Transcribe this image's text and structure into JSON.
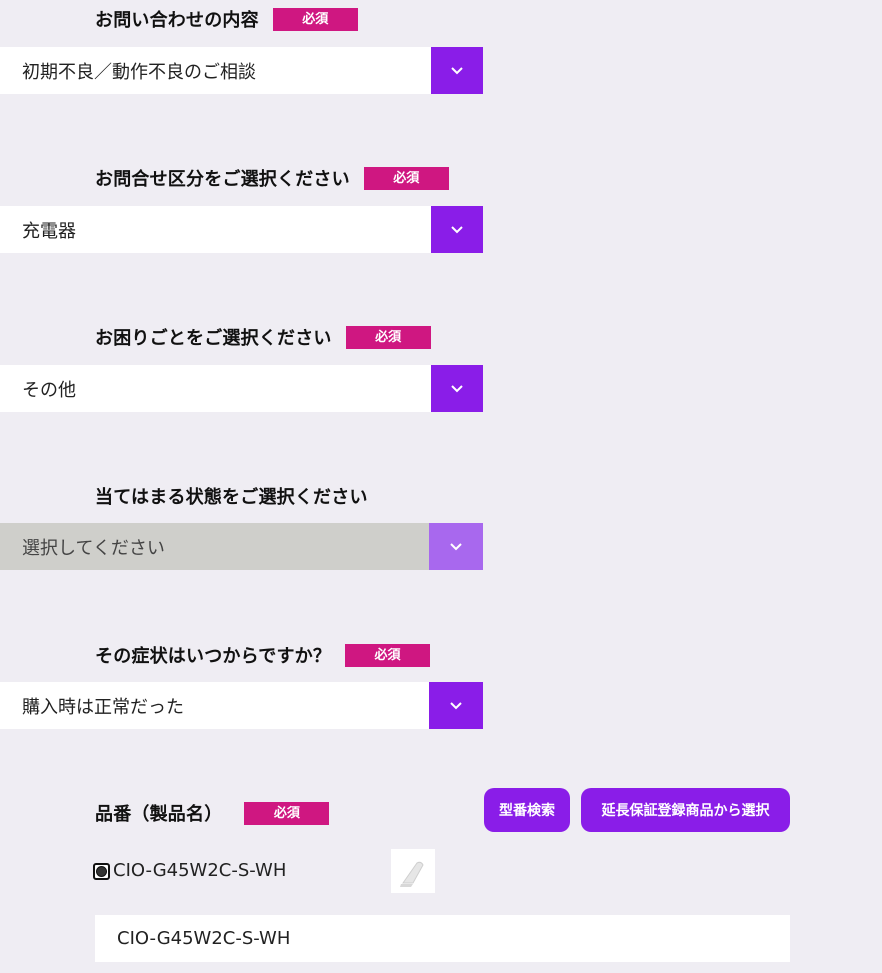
{
  "required_badge": "必須",
  "fields": [
    {
      "label": "お問い合わせの内容",
      "value": "初期不良／動作不良のご相談",
      "required": true
    },
    {
      "label": "お問合せ区分をご選択ください",
      "value": "充電器",
      "required": true
    },
    {
      "label": "お困りごとをご選択ください",
      "value": "その他",
      "required": true
    },
    {
      "label": "当てはまる状態をご選択ください",
      "value": "選択してください",
      "required": false
    },
    {
      "label": "その症状はいつからですか？",
      "value": "購入時は正常だった",
      "required": true
    }
  ],
  "product": {
    "label": "品番（製品名）",
    "search_button": "型番検索",
    "warranty_button": "延長保証登録商品から選択",
    "selected_option": "CIO-G45W2C-S-WH",
    "input_value": "CIO-G45W2C-S-WH"
  },
  "colors": {
    "accent": "#8a1de8",
    "required_badge": "#cf1781",
    "background": "#efedf3"
  }
}
